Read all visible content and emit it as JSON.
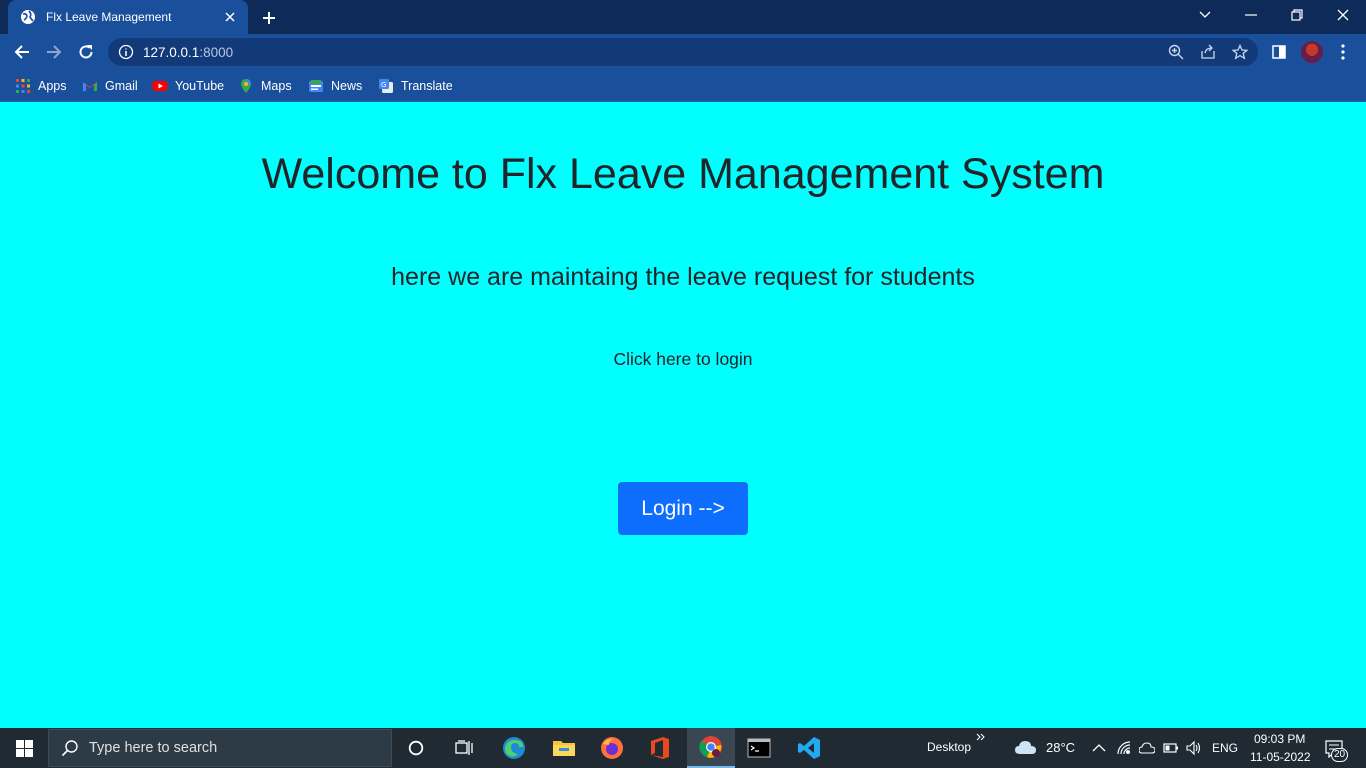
{
  "browser": {
    "tab_title": "Flx Leave Management",
    "url_host": "127.0.0.1",
    "url_port": ":8000",
    "bookmarks": [
      {
        "label": "Apps",
        "icon": "apps-grid-icon"
      },
      {
        "label": "Gmail",
        "icon": "gmail-icon"
      },
      {
        "label": "YouTube",
        "icon": "youtube-icon"
      },
      {
        "label": "Maps",
        "icon": "maps-icon"
      },
      {
        "label": "News",
        "icon": "news-icon"
      },
      {
        "label": "Translate",
        "icon": "translate-icon"
      }
    ]
  },
  "page": {
    "heading": "Welcome to Flx Leave Management System",
    "subheading": "here we are maintaing the leave request for students",
    "lead": "Click here to login",
    "login_button": "Login -->",
    "background_color": "#00ffff",
    "button_color": "#0d6efd"
  },
  "taskbar": {
    "search_placeholder": "Type here to search",
    "desktop_label": "Desktop",
    "weather": "28°C",
    "language": "ENG",
    "time": "09:03 PM",
    "date": "11-05-2022",
    "notifications": "20"
  }
}
